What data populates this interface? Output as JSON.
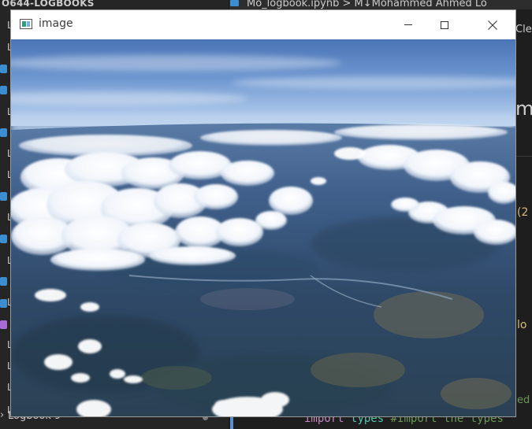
{
  "background_editor": {
    "explorer_title": "O644-LOGBOOKS",
    "sidebar_rows": [
      {
        "letter": "L",
        "icon": "none"
      },
      {
        "letter": "L",
        "icon": "none"
      },
      {
        "letter": "",
        "icon": "notebook-icon"
      },
      {
        "letter": "",
        "icon": "notebook-icon"
      },
      {
        "letter": "L",
        "icon": "none"
      },
      {
        "letter": "",
        "icon": "notebook-icon"
      },
      {
        "letter": "L",
        "icon": "none"
      },
      {
        "letter": "L",
        "icon": "none"
      },
      {
        "letter": "",
        "icon": "notebook-icon"
      },
      {
        "letter": "L",
        "icon": "none"
      },
      {
        "letter": "",
        "icon": "notebook-icon"
      },
      {
        "letter": "L",
        "icon": "none"
      },
      {
        "letter": "",
        "icon": "notebook-icon"
      },
      {
        "letter": "L",
        "icon": "none"
      },
      {
        "letter": "",
        "icon": "notebook-icon"
      },
      {
        "letter": "",
        "icon": "image-file-icon"
      },
      {
        "letter": "L",
        "icon": "none"
      },
      {
        "letter": "L",
        "icon": "none"
      },
      {
        "letter": "L",
        "icon": "none"
      },
      {
        "letter": "L",
        "icon": "none"
      }
    ],
    "bottom_item_label": "Logbook 9",
    "breadcrumb": "Mo_logbook.ipynb > M↓Mohammed Ahmed Lo",
    "clear_text": "Clea",
    "right_heading_fragment": "m",
    "right_fragment_2": "(2",
    "right_fragment_lo": "lo",
    "right_fragment_ed": "ed",
    "code_line": {
      "import": "import",
      "module": "types",
      "comment": "#Import the types"
    }
  },
  "image_window": {
    "title": "image",
    "minimize_label": "—",
    "close_label": "✕"
  },
  "colors": {
    "sky_top": "#4d77b8",
    "horizon": "#bcd3ee",
    "land": "#33506e",
    "cloud": "#ffffff"
  }
}
